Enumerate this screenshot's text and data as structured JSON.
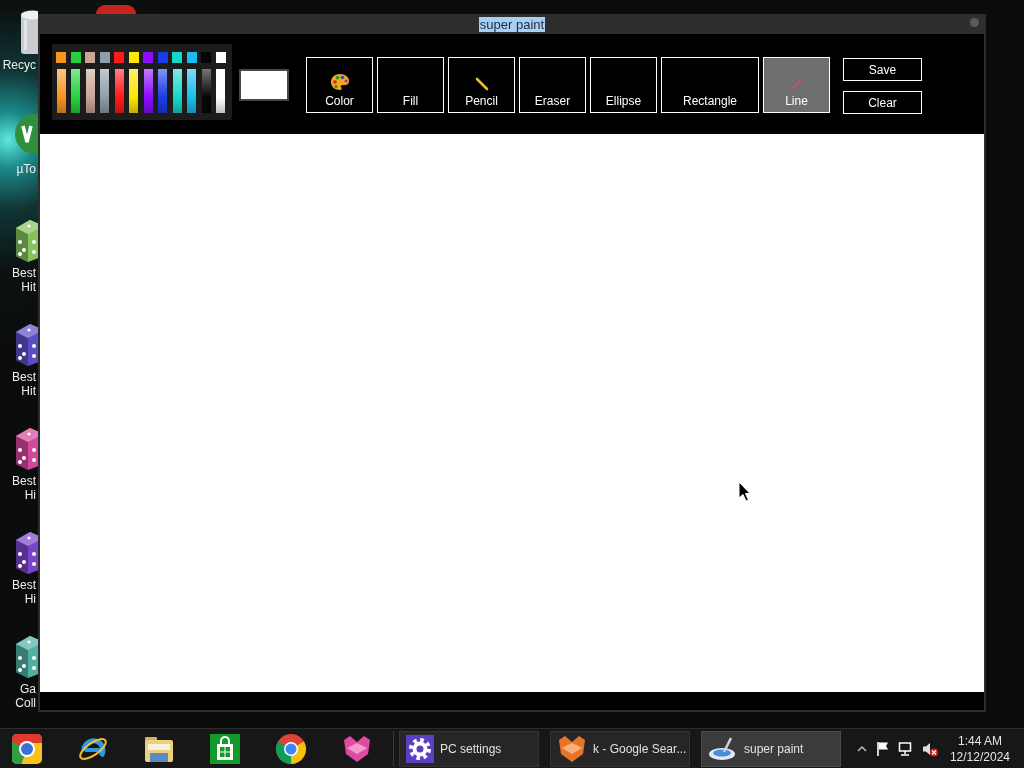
{
  "desktop": {
    "icons": [
      {
        "kind": "bin",
        "label_lines": [
          "Recyc"
        ]
      },
      {
        "kind": "torrent",
        "label_lines": [
          "µTo"
        ]
      },
      {
        "kind": "dice",
        "color": "#86c25e",
        "label_lines": [
          "Best",
          "Hit"
        ]
      },
      {
        "kind": "dice",
        "color": "#5a4ec4",
        "label_lines": [
          "Best",
          "Hit"
        ]
      },
      {
        "kind": "dice",
        "color": "#d2489a",
        "label_lines": [
          "Best",
          "Hi"
        ]
      },
      {
        "kind": "dice",
        "color": "#7a44c8",
        "label_lines": [
          "Best",
          "Hi"
        ]
      },
      {
        "kind": "dice",
        "color": "#4fb0a4",
        "label_lines": [
          "Ga",
          "Coll"
        ]
      }
    ]
  },
  "window": {
    "title": "super paint",
    "title_highlighted": true,
    "palette": {
      "swatches": [
        {
          "color": "#f7941d"
        },
        {
          "color": "#22d43c"
        },
        {
          "color": "#c9a596"
        },
        {
          "color": "#8f9ea8"
        },
        {
          "color": "#ff1a1a"
        },
        {
          "color": "#ffe600"
        },
        {
          "color": "#8a0dff"
        },
        {
          "color": "#1a3ce6"
        },
        {
          "color": "#16d6c8"
        },
        {
          "color": "#19bdf0"
        },
        {
          "color": "#050505"
        },
        {
          "color": "#ffffff"
        }
      ]
    },
    "tools": [
      {
        "label": "Color",
        "kind": "palette",
        "wide": false,
        "selected": false
      },
      {
        "label": "Fill",
        "kind": "plain",
        "wide": false,
        "selected": false
      },
      {
        "label": "Pencil",
        "kind": "pencil",
        "wide": false,
        "selected": false
      },
      {
        "label": "Eraser",
        "kind": "plain",
        "wide": false,
        "selected": false
      },
      {
        "label": "Ellipse",
        "kind": "plain",
        "wide": false,
        "selected": false
      },
      {
        "label": "Rectangle",
        "kind": "plain",
        "wide": true,
        "selected": false
      },
      {
        "label": "Line",
        "kind": "line",
        "wide": false,
        "selected": true
      }
    ],
    "actions": [
      {
        "label": "Save"
      },
      {
        "label": "Clear"
      }
    ]
  },
  "taskbar": {
    "pinned": [
      {
        "kind": "canary"
      },
      {
        "kind": "ie"
      },
      {
        "kind": "folder"
      },
      {
        "kind": "store"
      },
      {
        "kind": "chrome"
      },
      {
        "kind": "pinkfox"
      }
    ],
    "tasks": [
      {
        "label": "PC settings",
        "kind": "gear",
        "active": false
      },
      {
        "label": "k - Google Sear...",
        "kind": "fox",
        "active": false
      },
      {
        "label": "super paint",
        "kind": "paint",
        "active": true
      }
    ],
    "clock": {
      "time": "1:44 AM",
      "date": "12/12/2024"
    }
  }
}
